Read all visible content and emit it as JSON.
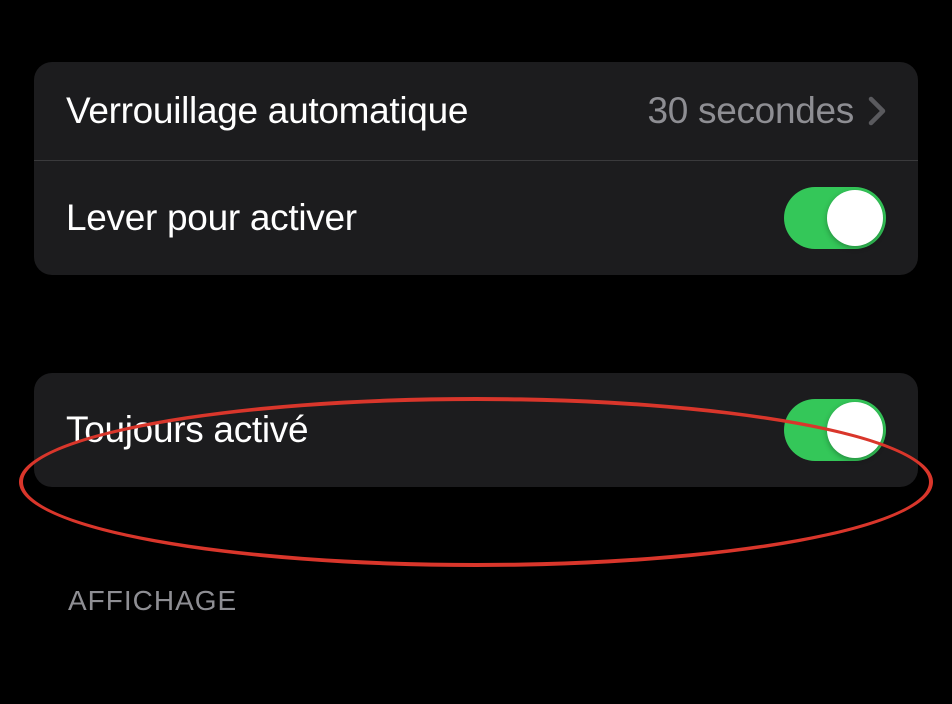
{
  "group1": {
    "row1": {
      "label": "Verrouillage automatique",
      "value": "30 secondes"
    },
    "row2": {
      "label": "Lever pour activer",
      "toggle": true
    }
  },
  "group2": {
    "row1": {
      "label": "Toujours activé",
      "toggle": true
    }
  },
  "section_header": "AFFICHAGE",
  "annotation": {
    "highlight_color": "#d9362b"
  }
}
